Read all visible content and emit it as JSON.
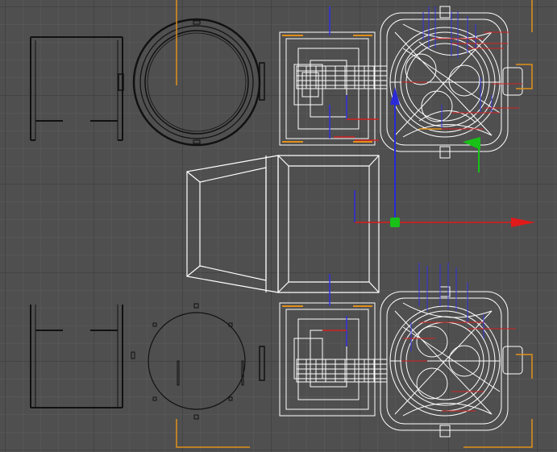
{
  "viewport": {
    "background": "#4f4f4f",
    "grid_minor_color": "#5c5c5c",
    "grid_major_color": "#3a3a3a",
    "wire_white": "#ffffff",
    "wire_black": "#111111",
    "selection_orange": "#e0901a",
    "axis_x_color": "#e01a1a",
    "axis_y_color": "#18c018",
    "axis_z_color": "#2a2ad8",
    "detail_red": "#d42020",
    "detail_blue": "#3030e0"
  },
  "gizmo": {
    "center_icon": "green-cube-icon",
    "x_arrow_icon": "red-arrow-icon",
    "y_arrow_icon": "green-arrow-icon",
    "z_arrow_icon": "blue-arrow-icon"
  }
}
